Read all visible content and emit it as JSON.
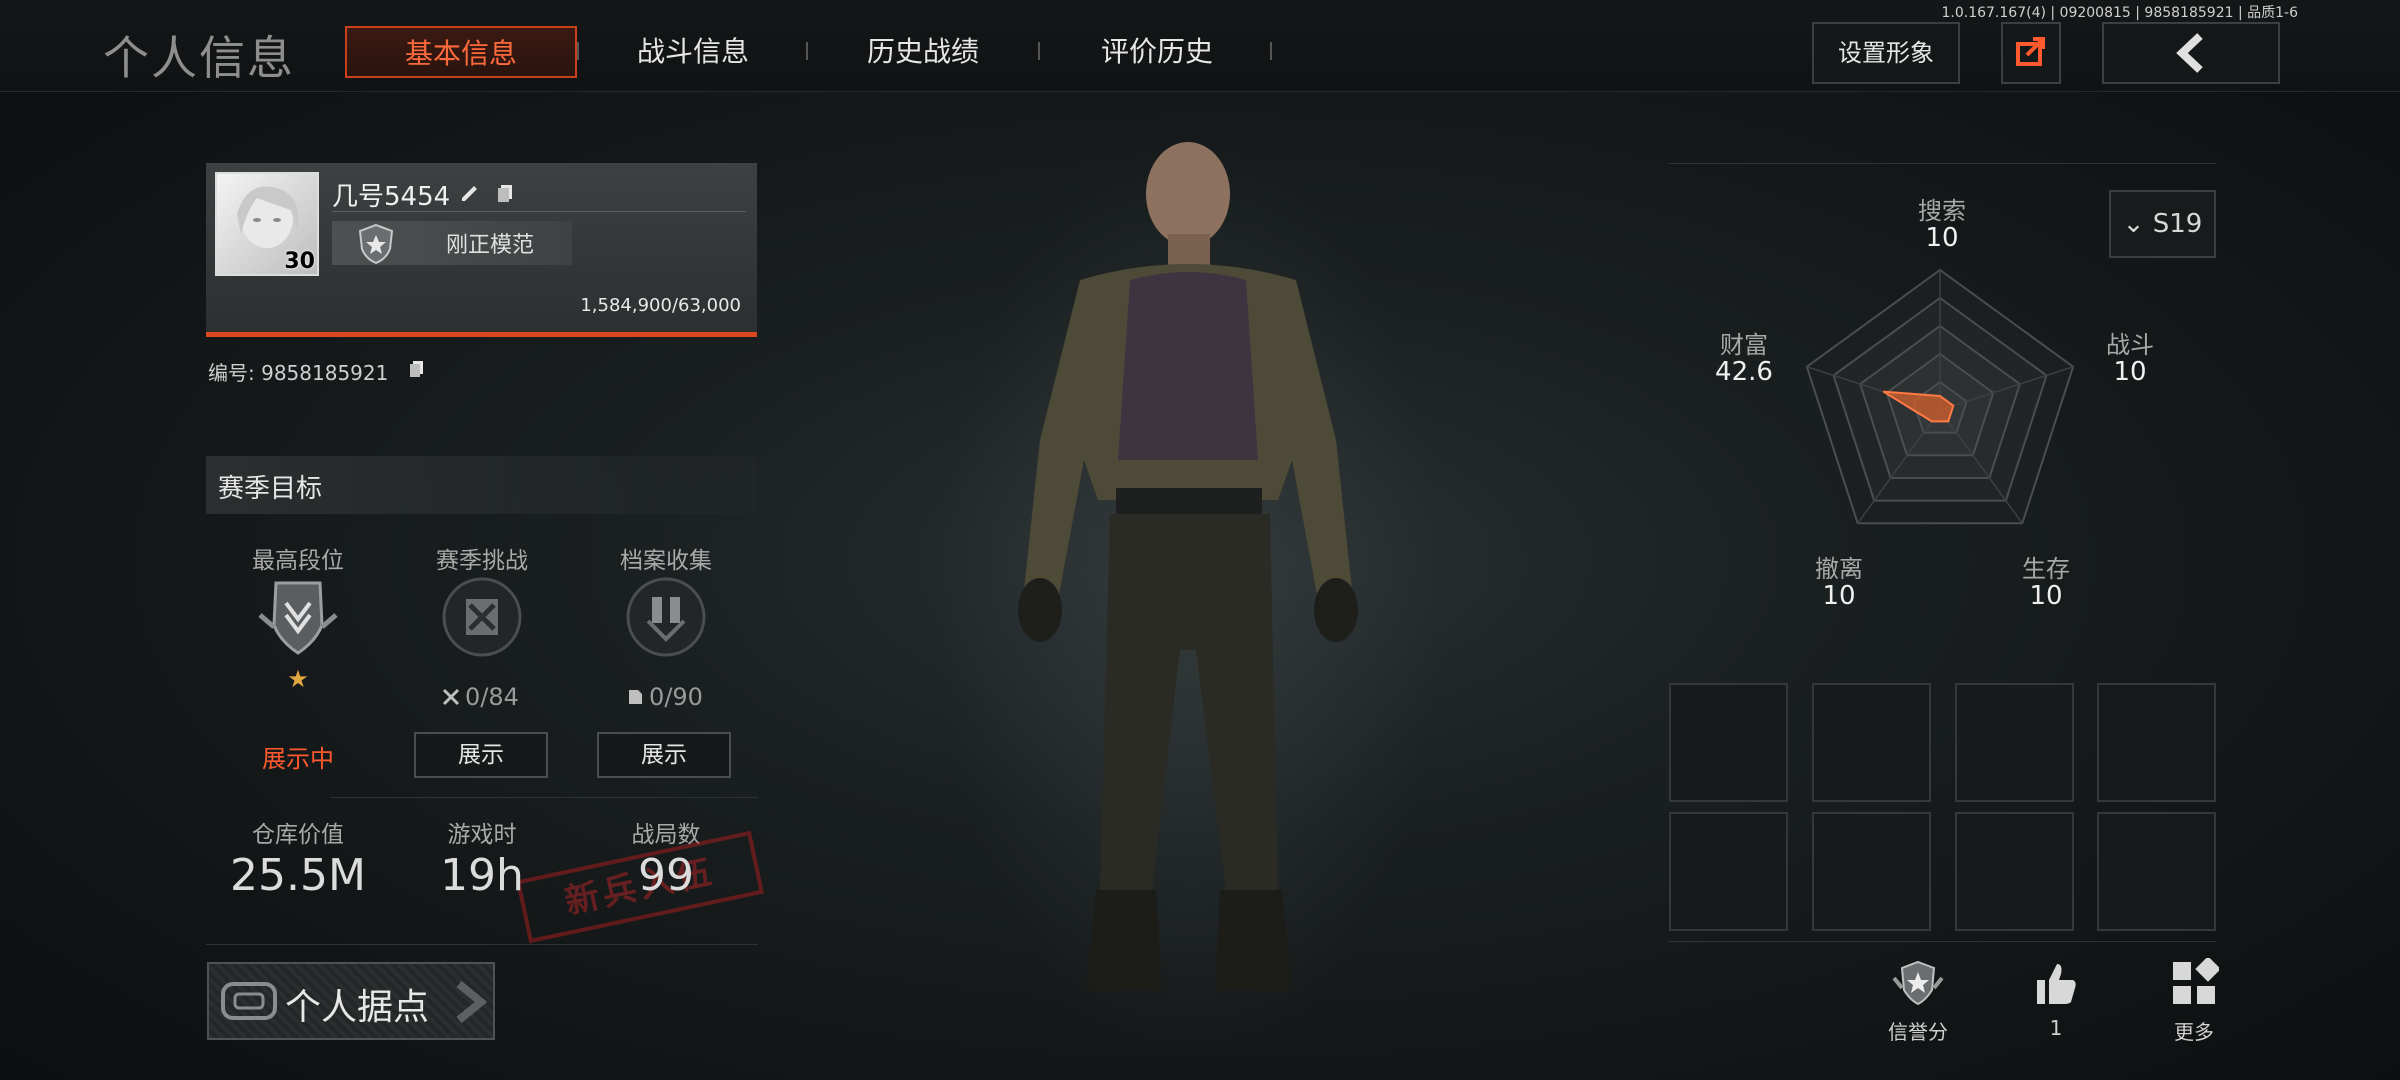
{
  "header": {
    "title": "个人信息",
    "tabs": [
      {
        "label": "基本信息",
        "active": true
      },
      {
        "label": "战斗信息",
        "active": false
      },
      {
        "label": "历史战绩",
        "active": false
      },
      {
        "label": "评价历史",
        "active": false
      }
    ],
    "set_appearance_label": "设置形象",
    "build_info": "1.0.167.167(4) | 09200815 | 9858185921 | 品质1-6"
  },
  "profile": {
    "username": "几号5454",
    "level": "30",
    "title_badge": "刚正模范",
    "exp_text": "1,584,900/63,000",
    "id_text": "编号: 9858185921"
  },
  "season_goals": {
    "title": "赛季目标",
    "items": [
      {
        "label": "最高段位",
        "sub": "★",
        "action": "展示中"
      },
      {
        "label": "赛季挑战",
        "sub": "0/84",
        "action": "展示"
      },
      {
        "label": "档案收集",
        "sub": "0/90",
        "action": "展示"
      }
    ]
  },
  "stats": [
    {
      "label": "仓库价值",
      "value": "25.5M"
    },
    {
      "label": "游戏时",
      "value": "19h"
    },
    {
      "label": "战局数",
      "value": "99"
    }
  ],
  "base_button_label": "个人据点",
  "radar": {
    "season": "S19",
    "axes": [
      {
        "label": "搜索",
        "value": "10"
      },
      {
        "label": "战斗",
        "value": "10"
      },
      {
        "label": "生存",
        "value": "10"
      },
      {
        "label": "撤离",
        "value": "10"
      },
      {
        "label": "财富",
        "value": "42.6"
      }
    ]
  },
  "bottom_actions": [
    {
      "label": "信誉分",
      "icon": "credit-badge-icon"
    },
    {
      "label": "1",
      "icon": "thumbs-up-icon"
    },
    {
      "label": "更多",
      "icon": "more-grid-icon"
    }
  ],
  "colors": {
    "accent": "#ff5a2d",
    "radar_fill": "#d4622c"
  }
}
